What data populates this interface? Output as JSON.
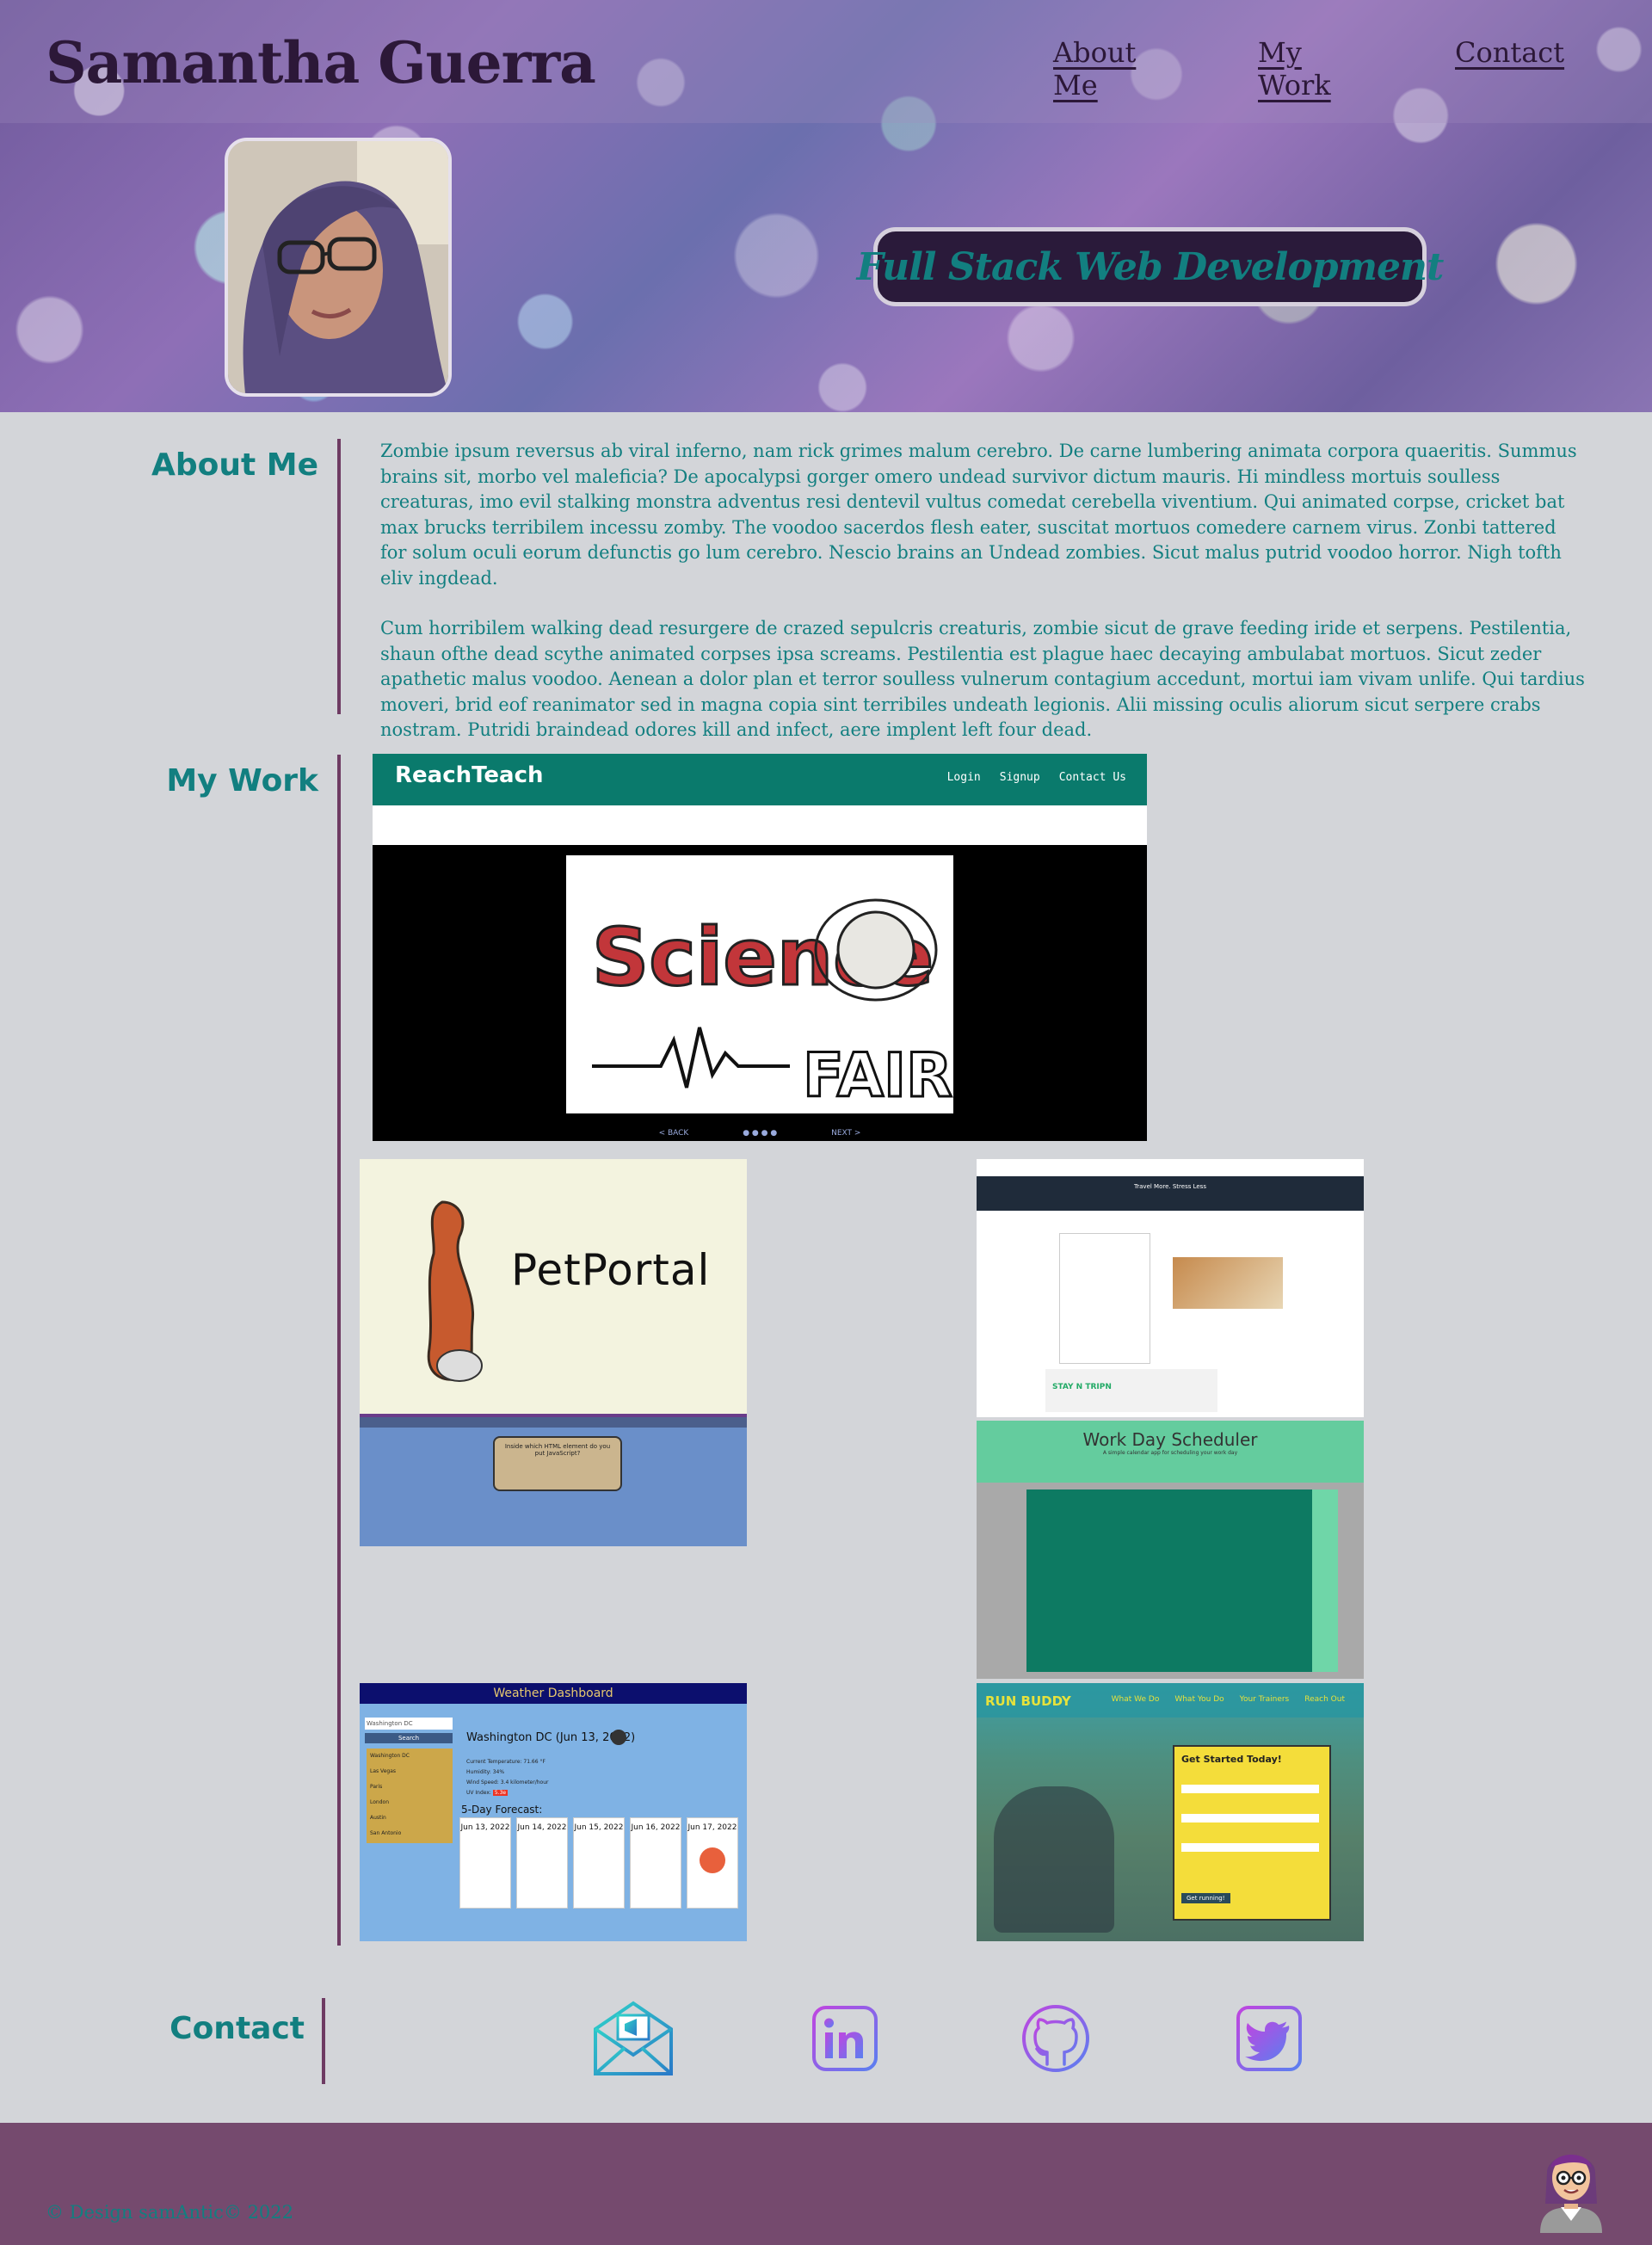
{
  "header": {
    "site_title": "Samantha Guerra",
    "nav": [
      "About Me",
      "My Work",
      "Contact"
    ],
    "tagline": "Full Stack Web Development"
  },
  "about": {
    "title": "About Me",
    "paragraphs": [
      "Zombie ipsum reversus ab viral inferno, nam rick grimes malum cerebro. De carne lumbering animata corpora quaeritis. Summus brains sit, morbo vel maleficia? De apocalypsi gorger omero undead survivor dictum mauris. Hi mindless mortuis soulless creaturas, imo evil stalking monstra adventus resi dentevil vultus comedat cerebella viventium. Qui animated corpse, cricket bat max brucks terribilem incessu zomby. The voodoo sacerdos flesh eater, suscitat mortuos comedere carnem virus. Zonbi tattered for solum oculi eorum defunctis go lum cerebro. Nescio brains an Undead zombies. Sicut malus putrid voodoo horror. Nigh tofth eliv ingdead.",
      "Cum horribilem walking dead resurgere de crazed sepulcris creaturis, zombie sicut de grave feeding iride et serpens. Pestilentia, shaun ofthe dead scythe animated corpses ipsa screams. Pestilentia est plague haec decaying ambulabat mortuos. Sicut zeder apathetic malus voodoo. Aenean a dolor plan et terror soulless vulnerum contagium accedunt, mortui iam vivam unlife. Qui tardius moveri, brid eof reanimator sed in magna copia sint terribiles undeath legionis. Alii missing oculis aliorum sicut serpere crabs nostram. Putridi braindead odores kill and infect, aere implent left four dead."
    ]
  },
  "work": {
    "title": "My Work",
    "reachteach": {
      "brand": "ReachTeach",
      "nav": [
        "Login",
        "Signup",
        "Contact Us"
      ],
      "card_line1": "Science",
      "card_line2": "FAIR",
      "back": "< BACK",
      "next": "NEXT >"
    },
    "petportal": {
      "name": "PetPortal",
      "question": "Inside which HTML element do you put JavaScript?"
    },
    "stayntripn": {
      "heading": "Travel More. Stress Less",
      "brand": "STAY N TRIPN"
    },
    "scheduler": {
      "title": "Work Day Scheduler",
      "subtitle": "A simple calendar app for scheduling your work day"
    },
    "weather": {
      "title": "Weather Dashboard",
      "search_placeholder": "Washington DC",
      "search_button": "Search",
      "cities": [
        "Washington DC",
        "Las Vegas",
        "Paris",
        "London",
        "Austin",
        "San Antonio"
      ],
      "current": "Washington DC (Jun 13, 2022)",
      "stats": [
        "Current Temperature: 71.66 °F",
        "Humidity: 34%",
        "Wind Speed: 3.4 kilometer/hour",
        "UV Index:"
      ],
      "uv": "5.3e",
      "forecast_label": "5-Day Forecast:",
      "forecast_days": [
        "Jun 13, 2022",
        "Jun 14, 2022",
        "Jun 15, 2022",
        "Jun 16, 2022",
        "Jun 17, 2022"
      ]
    },
    "runbuddy": {
      "brand": "RUN BUDDY",
      "links": [
        "What We Do",
        "What You Do",
        "Your Trainers",
        "Reach Out"
      ],
      "form_title": "Get Started Today!",
      "form_button": "Get running!"
    }
  },
  "contact": {
    "title": "Contact",
    "icons": [
      "email-icon",
      "linkedin-icon",
      "github-icon",
      "twitter-icon"
    ]
  },
  "footer": {
    "text": "© Design samAntic© 2022"
  }
}
